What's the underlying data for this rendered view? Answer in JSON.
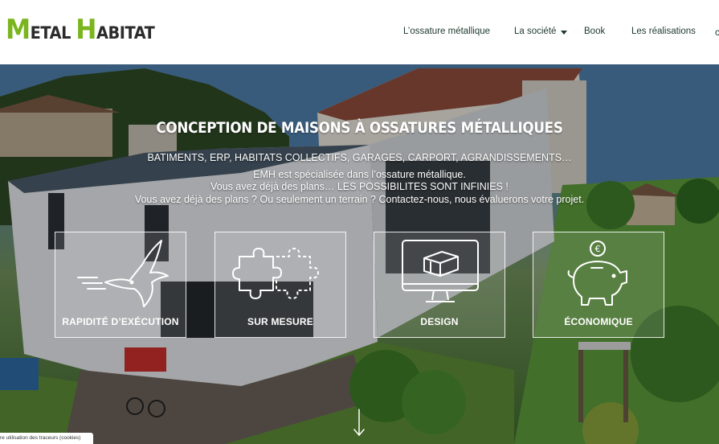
{
  "header": {
    "logo": {
      "first_cap": "M",
      "first_rest": "ETAL",
      "second_cap": "H",
      "second_rest": "ABITAT"
    },
    "nav": [
      {
        "label": "L’ossature métallique"
      },
      {
        "label": "La société"
      },
      {
        "label": "Book"
      },
      {
        "label": "Les réalisations"
      }
    ]
  },
  "hero": {
    "title": "CONCEPTION DE MAISONS À OSSATURES MÉTALLIQUES",
    "line1": "BATIMENTS, ERP, HABITATS COLLECTIFS, GARAGES, CARPORT, AGRANDISSEMENTS…",
    "line2": "EMH est spécialisée dans l’ossature métallique.",
    "line3": "Vous avez déjà des plans… LES POSSIBILITES SONT INFINIES !",
    "line4": "Vous avez déjà des plans ? Ou seulement un terrain ? Contactez-nous, nous évaluerons votre projet."
  },
  "features": [
    {
      "label": "RAPIDITÉ D’EXÉCUTION",
      "icon": "swallow-icon"
    },
    {
      "label": "SUR MESURE",
      "icon": "puzzle-icon"
    },
    {
      "label": "DESIGN",
      "icon": "monitor-icon"
    },
    {
      "label": "ÉCONOMIQUE",
      "icon": "piggy-bank-icon"
    }
  ],
  "cookie_banner": {
    "text": "re utilisation des traceurs (cookies)"
  },
  "colors": {
    "brand_green": "#7ab51d",
    "nav_text": "#1d3a2c"
  }
}
